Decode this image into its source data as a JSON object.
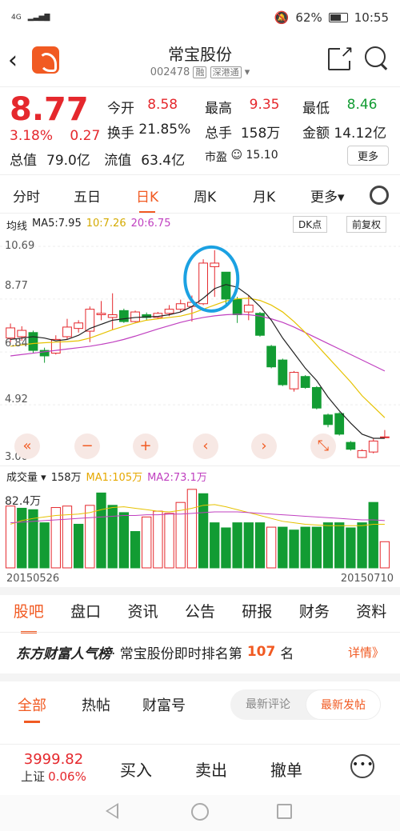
{
  "statusbar": {
    "network": "4G",
    "battery": "62%",
    "time": "10:55"
  },
  "header": {
    "stock_name": "常宝股份",
    "stock_code": "002478",
    "tag1": "融",
    "tag2": "深港通"
  },
  "quote": {
    "price": "8.77",
    "change_pct": "3.18%",
    "change": "0.27",
    "total_value_label": "总值",
    "total_value": "79.0亿",
    "float_value_label": "流值",
    "float_value": "63.4亿",
    "rows": [
      [
        {
          "label": "今开",
          "value": "8.58",
          "color": "red"
        },
        {
          "label": "最高",
          "value": "9.35",
          "color": "red"
        },
        {
          "label": "最低",
          "value": "8.46",
          "color": "green"
        }
      ],
      [
        {
          "label": "换手",
          "value": "21.85%",
          "color": "black"
        },
        {
          "label": "总手",
          "value": "158万",
          "color": "black"
        },
        {
          "label": "金额",
          "value": "14.12亿",
          "color": "black"
        }
      ]
    ],
    "pe_label": "市盈",
    "pe_value": "15.10",
    "more_label": "更多"
  },
  "ktabs": [
    {
      "label": "分时",
      "active": false
    },
    {
      "label": "五日",
      "active": false
    },
    {
      "label": "日K",
      "active": true
    },
    {
      "label": "周K",
      "active": false
    },
    {
      "label": "月K",
      "active": false
    },
    {
      "label": "更多▾",
      "active": false
    }
  ],
  "ma_legend": {
    "label": "均线",
    "ma5": "MA5:7.95",
    "ma10": "10:7.26",
    "ma20": "20:6.75"
  },
  "dk_label": "DK点",
  "fq_label": "前复权",
  "colors": {
    "accent": "#f15a22",
    "up": "#e5282d",
    "down": "#129c33",
    "ma5": "#222222",
    "ma10": "#e6c200",
    "ma20": "#c040c0",
    "annotation": "#1ba1e2"
  },
  "chart_data": {
    "type": "candlestick",
    "y_ticks": [
      "10.69",
      "8.77",
      "6.84",
      "4.92",
      "3.00"
    ],
    "ylim": [
      3.0,
      10.69
    ],
    "x_labels": [
      "20150526",
      "20150710"
    ],
    "candles": [
      {
        "o": 7.35,
        "c": 7.72,
        "h": 7.88,
        "l": 7.2
      },
      {
        "o": 7.4,
        "c": 7.63,
        "h": 7.78,
        "l": 7.25
      },
      {
        "o": 7.55,
        "c": 6.9,
        "h": 7.62,
        "l": 6.8
      },
      {
        "o": 6.9,
        "c": 6.7,
        "h": 7.0,
        "l": 6.45
      },
      {
        "o": 6.8,
        "c": 7.3,
        "h": 7.45,
        "l": 6.75
      },
      {
        "o": 7.4,
        "c": 7.75,
        "h": 8.05,
        "l": 7.3
      },
      {
        "o": 7.7,
        "c": 7.9,
        "h": 8.0,
        "l": 7.55
      },
      {
        "o": 7.6,
        "c": 8.4,
        "h": 8.5,
        "l": 7.2
      },
      {
        "o": 8.2,
        "c": 8.25,
        "h": 8.7,
        "l": 8.0
      },
      {
        "o": 8.1,
        "c": 8.2,
        "h": 8.98,
        "l": 7.65
      },
      {
        "o": 8.35,
        "c": 7.95,
        "h": 8.42,
        "l": 7.9
      },
      {
        "o": 7.95,
        "c": 8.3,
        "h": 8.35,
        "l": 7.92
      },
      {
        "o": 8.2,
        "c": 8.1,
        "h": 8.28,
        "l": 8.0
      },
      {
        "o": 8.1,
        "c": 8.25,
        "h": 8.3,
        "l": 8.05
      },
      {
        "o": 8.25,
        "c": 8.4,
        "h": 8.55,
        "l": 8.15
      },
      {
        "o": 8.4,
        "c": 8.6,
        "h": 8.75,
        "l": 8.3
      },
      {
        "o": 8.5,
        "c": 8.65,
        "h": 8.9,
        "l": 7.95
      },
      {
        "o": 8.6,
        "c": 10.08,
        "h": 10.22,
        "l": 8.55
      },
      {
        "o": 9.95,
        "c": 10.08,
        "h": 10.55,
        "l": 8.85
      },
      {
        "o": 9.75,
        "c": 8.77,
        "h": 9.35,
        "l": 8.46
      },
      {
        "o": 8.77,
        "c": 8.2,
        "h": 8.85,
        "l": 7.9
      },
      {
        "o": 8.3,
        "c": 8.55,
        "h": 8.9,
        "l": 8.0
      },
      {
        "o": 8.25,
        "c": 7.45,
        "h": 8.3,
        "l": 7.4
      },
      {
        "o": 7.05,
        "c": 6.3,
        "h": 7.1,
        "l": 6.25
      },
      {
        "o": 6.55,
        "c": 5.65,
        "h": 6.6,
        "l": 5.6
      },
      {
        "o": 5.5,
        "c": 6.1,
        "h": 6.15,
        "l": 5.4
      },
      {
        "o": 5.95,
        "c": 5.55,
        "h": 6.0,
        "l": 5.5
      },
      {
        "o": 5.55,
        "c": 4.8,
        "h": 5.6,
        "l": 4.75
      },
      {
        "o": 4.55,
        "c": 4.2,
        "h": 4.6,
        "l": 4.1
      },
      {
        "o": 4.6,
        "c": 3.85,
        "h": 4.65,
        "l": 3.8
      },
      {
        "o": 3.55,
        "c": 3.3,
        "h": 3.6,
        "l": 3.25
      },
      {
        "o": 3.0,
        "c": 3.25,
        "h": 3.3,
        "l": 2.98
      },
      {
        "o": 3.2,
        "c": 3.6,
        "h": 3.68,
        "l": 3.15
      },
      {
        "o": 3.75,
        "c": 3.75,
        "h": 4.0,
        "l": 3.7
      }
    ],
    "ma5": [
      7.3,
      7.35,
      7.4,
      7.35,
      7.25,
      7.3,
      7.45,
      7.7,
      7.85,
      8.0,
      8.05,
      8.1,
      8.12,
      8.14,
      8.2,
      8.3,
      8.5,
      8.8,
      9.15,
      9.3,
      9.2,
      8.9,
      8.5,
      8.0,
      7.35,
      6.8,
      6.25,
      5.8,
      5.2,
      4.7,
      4.25,
      3.85,
      3.7,
      3.7
    ],
    "ma10": [
      7.05,
      7.1,
      7.15,
      7.18,
      7.2,
      7.22,
      7.25,
      7.35,
      7.5,
      7.65,
      7.78,
      7.9,
      8.0,
      8.05,
      8.1,
      8.15,
      8.25,
      8.4,
      8.55,
      8.7,
      8.78,
      8.8,
      8.72,
      8.55,
      8.3,
      7.95,
      7.55,
      7.1,
      6.65,
      6.2,
      5.75,
      5.25,
      4.85,
      4.45
    ],
    "ma20": [
      6.7,
      6.75,
      6.8,
      6.85,
      6.9,
      6.95,
      7.0,
      7.05,
      7.12,
      7.2,
      7.3,
      7.42,
      7.55,
      7.68,
      7.8,
      7.92,
      8.02,
      8.1,
      8.16,
      8.2,
      8.22,
      8.2,
      8.15,
      8.05,
      7.92,
      7.75,
      7.55,
      7.35,
      7.15,
      6.95,
      6.75,
      6.55,
      6.35,
      6.15
    ]
  },
  "controls": [
    "«",
    "−",
    "+",
    "‹",
    "›",
    "⤡"
  ],
  "volume": {
    "label": "成交量",
    "total": "158万",
    "ma1": "MA1:105万",
    "ma2": "MA2:73.1万",
    "y_tick": "82.4万",
    "bars": [
      {
        "v": 85,
        "up": true
      },
      {
        "v": 82,
        "up": false
      },
      {
        "v": 80,
        "up": false
      },
      {
        "v": 62,
        "up": false
      },
      {
        "v": 83,
        "up": true
      },
      {
        "v": 85,
        "up": true
      },
      {
        "v": 60,
        "up": false
      },
      {
        "v": 86,
        "up": true
      },
      {
        "v": 103,
        "up": false
      },
      {
        "v": 86,
        "up": false
      },
      {
        "v": 76,
        "up": false
      },
      {
        "v": 50,
        "up": false
      },
      {
        "v": 70,
        "up": true
      },
      {
        "v": 78,
        "up": true
      },
      {
        "v": 75,
        "up": true
      },
      {
        "v": 90,
        "up": true
      },
      {
        "v": 108,
        "up": true
      },
      {
        "v": 102,
        "up": false
      },
      {
        "v": 62,
        "up": false
      },
      {
        "v": 55,
        "up": false
      },
      {
        "v": 62,
        "up": false
      },
      {
        "v": 62,
        "up": false
      },
      {
        "v": 62,
        "up": false
      },
      {
        "v": 56,
        "up": true
      },
      {
        "v": 56,
        "up": false
      },
      {
        "v": 52,
        "up": false
      },
      {
        "v": 56,
        "up": false
      },
      {
        "v": 56,
        "up": false
      },
      {
        "v": 62,
        "up": false
      },
      {
        "v": 62,
        "up": false
      },
      {
        "v": 55,
        "up": false
      },
      {
        "v": 62,
        "up": false
      },
      {
        "v": 90,
        "up": false
      },
      {
        "v": 36,
        "up": true
      }
    ],
    "vma1": [
      60,
      65,
      68,
      70,
      72,
      73,
      74,
      76,
      80,
      83,
      84,
      82,
      80,
      78,
      77,
      79,
      82,
      86,
      87,
      84,
      80,
      76,
      72,
      68,
      64,
      62,
      60,
      59,
      58,
      58,
      58,
      58,
      60,
      60
    ],
    "vma2": [
      62,
      63,
      64,
      65,
      66,
      67,
      68,
      69,
      70,
      71,
      72,
      72,
      73,
      73,
      74,
      74,
      75,
      76,
      77,
      77,
      77,
      76,
      75,
      74,
      73,
      72,
      71,
      70,
      69,
      68,
      67,
      66,
      66,
      65
    ]
  },
  "info_tabs": [
    {
      "label": "股吧",
      "active": true
    },
    {
      "label": "盘口",
      "active": false
    },
    {
      "label": "资讯",
      "active": false
    },
    {
      "label": "公告",
      "active": false
    },
    {
      "label": "研报",
      "active": false
    },
    {
      "label": "财务",
      "active": false
    },
    {
      "label": "资料",
      "active": false
    }
  ],
  "rank": {
    "brand": "东方财富人气榜",
    "text": "· 常宝股份即时排名第",
    "num": "107",
    "unit": "名",
    "detail": "详情》"
  },
  "forum_tabs": [
    {
      "label": "全部",
      "active": true
    },
    {
      "label": "热帖",
      "active": false
    },
    {
      "label": "财富号",
      "active": false
    }
  ],
  "sort": {
    "opt1": "最新评论",
    "opt2": "最新发帖"
  },
  "bottom": {
    "index_value": "3999.82",
    "index_name": "上证",
    "index_chg": "0.06%",
    "buy": "买入",
    "sell": "卖出",
    "cancel": "撤单"
  }
}
